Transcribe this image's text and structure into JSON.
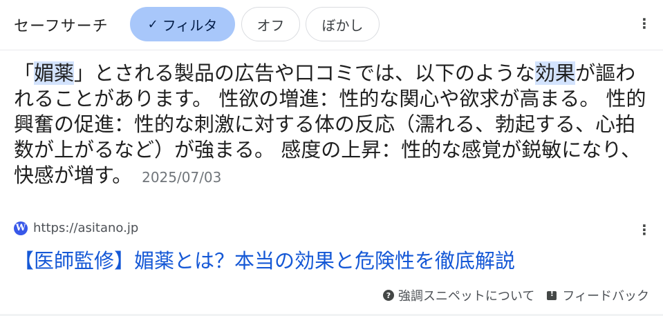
{
  "safesearch": {
    "label": "セーフサーチ",
    "filter_check": "✓",
    "filter_label": "フィルタ",
    "off_label": "オフ",
    "blur_label": "ぼかし",
    "menu_icon": "⋮"
  },
  "snippet": {
    "part1": "「",
    "hl1": "媚薬",
    "part2": "」とされる製品の広告や口コミでは、以下のような",
    "hl2": "効果",
    "part3": "が謳われることがあります。 性欲の増進：性的な関心や欲求が高まる。 性的興奮の促進：性的な刺激に対する体の反応（濡れる、勃起する、心拍数が上がるなど）が強まる。 感度の上昇：性的な感覚が鋭敏になり、快感が増す。",
    "date": "2025/07/03"
  },
  "result": {
    "favicon": "W",
    "url": "https://asitano.jp",
    "menu_icon": "⋮",
    "title": "【医師監修】媚薬とは？本当の効果と危険性を徹底解説"
  },
  "footer": {
    "help_icon": "?",
    "about_label": "強調スニペットについて",
    "feedback_label": "フィードバック"
  }
}
